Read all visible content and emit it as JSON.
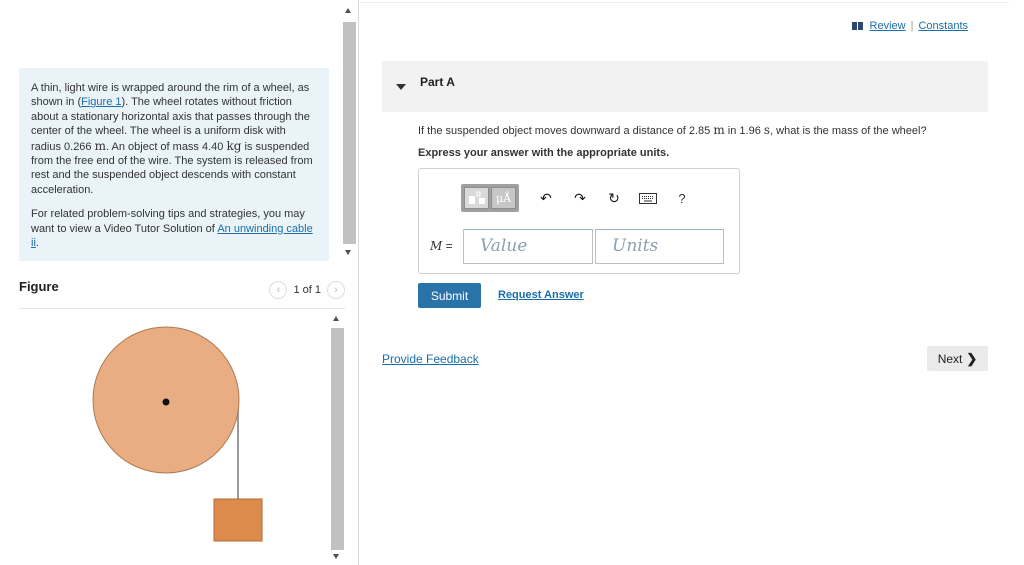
{
  "problem": {
    "text_1": "A thin, light wire is wrapped around the rim of a wheel, as shown in (",
    "figure_link": "Figure 1",
    "text_2": "). The wheel rotates without friction about a stationary horizontal axis that passes through the center of the wheel. The wheel is a uniform disk with radius 0.266 ",
    "unit_m": "m",
    "text_3": ". An object of mass 4.40 ",
    "unit_kg": "kg",
    "text_4": " is suspended from the free end of the wire. The system is released from rest and the suspended object descends with constant acceleration.",
    "tips_text": "For related problem-solving tips and strategies, you may want to view a Video Tutor Solution of ",
    "tips_link": "An unwinding cable ii",
    "tips_end": "."
  },
  "figure": {
    "title": "Figure",
    "page_indicator": "1 of 1",
    "wheel_color": "#e8ad82",
    "block_color": "#dd8b4c"
  },
  "header_links": {
    "review": "Review",
    "separator": "|",
    "constants": "Constants"
  },
  "part": {
    "title": "Part A",
    "question_1": "If the suspended object moves downward a distance of 2.85 ",
    "q_unit_m": "m",
    "question_2": " in 1.96 ",
    "q_unit_s": "s",
    "question_3": ", what is the mass of the wheel?",
    "instruction": "Express your answer with the appropriate units."
  },
  "toolbar": {
    "units_button": "μÅ",
    "help": "?"
  },
  "answer": {
    "variable": "M",
    "equals": "=",
    "value_placeholder": "Value",
    "units_placeholder": "Units"
  },
  "actions": {
    "submit": "Submit",
    "request_answer": "Request Answer",
    "provide_feedback": "Provide Feedback",
    "next": "Next"
  },
  "colors": {
    "accent": "#2a73a8",
    "link": "#1b6ea9",
    "problem_bg": "#e9f3f8"
  }
}
